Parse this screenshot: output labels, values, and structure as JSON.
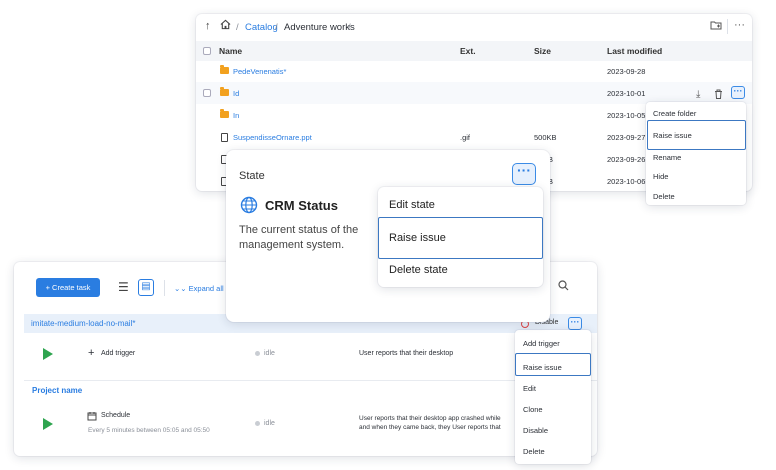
{
  "file_browser": {
    "breadcrumb": {
      "root": "Catalog",
      "current": "Adventure works",
      "sep": "/"
    },
    "columns": {
      "name": "Name",
      "ext": "Ext.",
      "size": "Size",
      "modified": "Last modified"
    },
    "rows": [
      {
        "name": "PedeVenenatis*",
        "type": "folder",
        "ext": "",
        "size": "",
        "modified": "2023-09-28"
      },
      {
        "name": "Id",
        "type": "folder",
        "ext": "",
        "size": "",
        "modified": "2023-10-01"
      },
      {
        "name": "In",
        "type": "folder",
        "ext": "",
        "size": "",
        "modified": "2023-10-05"
      },
      {
        "name": "SuspendisseOrnare.ppt",
        "type": "file",
        "ext": ".gif",
        "size": "500KB",
        "modified": "2023-09-27"
      },
      {
        "name": "",
        "type": "file",
        "ext": "",
        "size": "B",
        "modified": "2023-09-26"
      },
      {
        "name": "",
        "type": "file",
        "ext": "",
        "size": "B",
        "modified": "2023-10-06"
      }
    ],
    "context_menu": [
      "Create folder",
      "Raise issue",
      "Rename",
      "Hide",
      "Delete"
    ],
    "highlighted_item": "Raise issue"
  },
  "state_popover": {
    "label": "State",
    "title": "CRM Status",
    "description": "The current status of the management system.",
    "menu": [
      "Edit state",
      "Raise issue",
      "Delete state"
    ],
    "highlighted_item": "Raise issue"
  },
  "task_panel": {
    "create_button": "Create task",
    "expand_all": "Expand all",
    "group1": {
      "name": "imitate-medium-load-no-mail*",
      "disable_label": "Disable",
      "trigger": {
        "label": "Add trigger",
        "status": "idle",
        "message": "User reports that their desktop"
      }
    },
    "group2": {
      "name": "Project name",
      "schedule": {
        "label": "Schedule",
        "detail": "Every 5 minutes between 05:05 and 05:50",
        "status": "idle",
        "message_line1": "User reports that their desktop app crashed while",
        "message_line2": "and when they came back, they User reports that"
      }
    },
    "context_menu": [
      "Add trigger",
      "Raise issue",
      "Edit",
      "Clone",
      "Disable",
      "Delete"
    ],
    "highlighted_item": "Raise issue"
  },
  "colors": {
    "accent": "#2a7de1",
    "highlight_border": "#3c78c2",
    "folder": "#f2a11f",
    "play": "#2ea44f",
    "danger": "#e04646"
  }
}
